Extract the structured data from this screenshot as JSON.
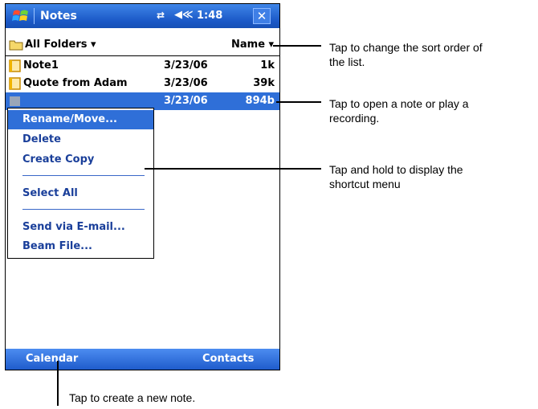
{
  "titlebar": {
    "app_title": "Notes",
    "time": "1:48",
    "close_label": "✕",
    "connectivity_glyph": "⇄",
    "volume_glyph": "◀≪"
  },
  "folderbar": {
    "folder_label": "All Folders ▾",
    "sort_label": "Name ▾"
  },
  "notes": [
    {
      "name": "Note1",
      "date": "3/23/06",
      "size": "1k"
    },
    {
      "name": "Quote from Adam",
      "date": "3/23/06",
      "size": "39k"
    },
    {
      "name": "",
      "date": "3/23/06",
      "size": "894b"
    }
  ],
  "context_menu": {
    "items": [
      "Rename/Move...",
      "Delete",
      "Create Copy",
      "Select All",
      "Send via E-mail...",
      "Beam File..."
    ]
  },
  "bottombar": {
    "left_label": "Calendar",
    "right_label": "Contacts"
  },
  "callouts": {
    "sort": [
      "Tap to change the sort order of",
      "the list."
    ],
    "open": [
      "Tap to open a note or play a",
      "recording."
    ],
    "hold": [
      "Tap and hold to display the",
      "shortcut menu"
    ],
    "new_note": "Tap to create a new note."
  },
  "colors": {
    "title_blue": "#1b59c7",
    "highlight": "#2f6fd8",
    "menu_text": "#1a3f9a"
  }
}
